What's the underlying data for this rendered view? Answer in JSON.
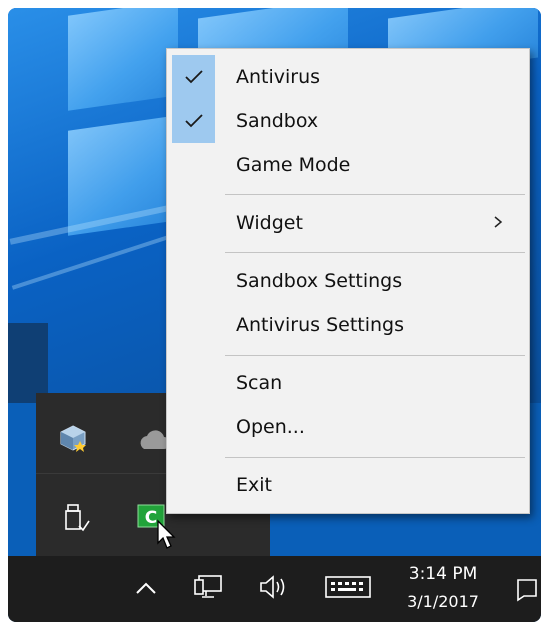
{
  "menu": {
    "items": [
      {
        "label": "Antivirus",
        "checked": true
      },
      {
        "label": "Sandbox",
        "checked": true
      },
      {
        "label": "Game Mode",
        "checked": false
      },
      {
        "label": "Widget",
        "submenu": true
      },
      {
        "label": "Sandbox Settings"
      },
      {
        "label": "Antivirus Settings"
      },
      {
        "label": "Scan"
      },
      {
        "label": "Open..."
      },
      {
        "label": "Exit"
      }
    ]
  },
  "tray_icons": [
    "virtualbox-icon",
    "onedrive-icon",
    "usb-eject-icon",
    "comodo-icon"
  ],
  "taskbar": {
    "clock_time": "3:14 PM",
    "clock_date": "3/1/2017",
    "icons": [
      "chevron-up-icon",
      "network-icon",
      "speaker-icon",
      "keyboard-icon"
    ]
  },
  "colors": {
    "menu_bg": "#f2f2f2",
    "check_highlight": "#9ec9ef",
    "taskbar_bg": "#1d1d1d",
    "tray_flyout_bg": "#2b2b2b",
    "desktop_blue": "#0a62c4",
    "comodo_green": "#22a33a"
  }
}
